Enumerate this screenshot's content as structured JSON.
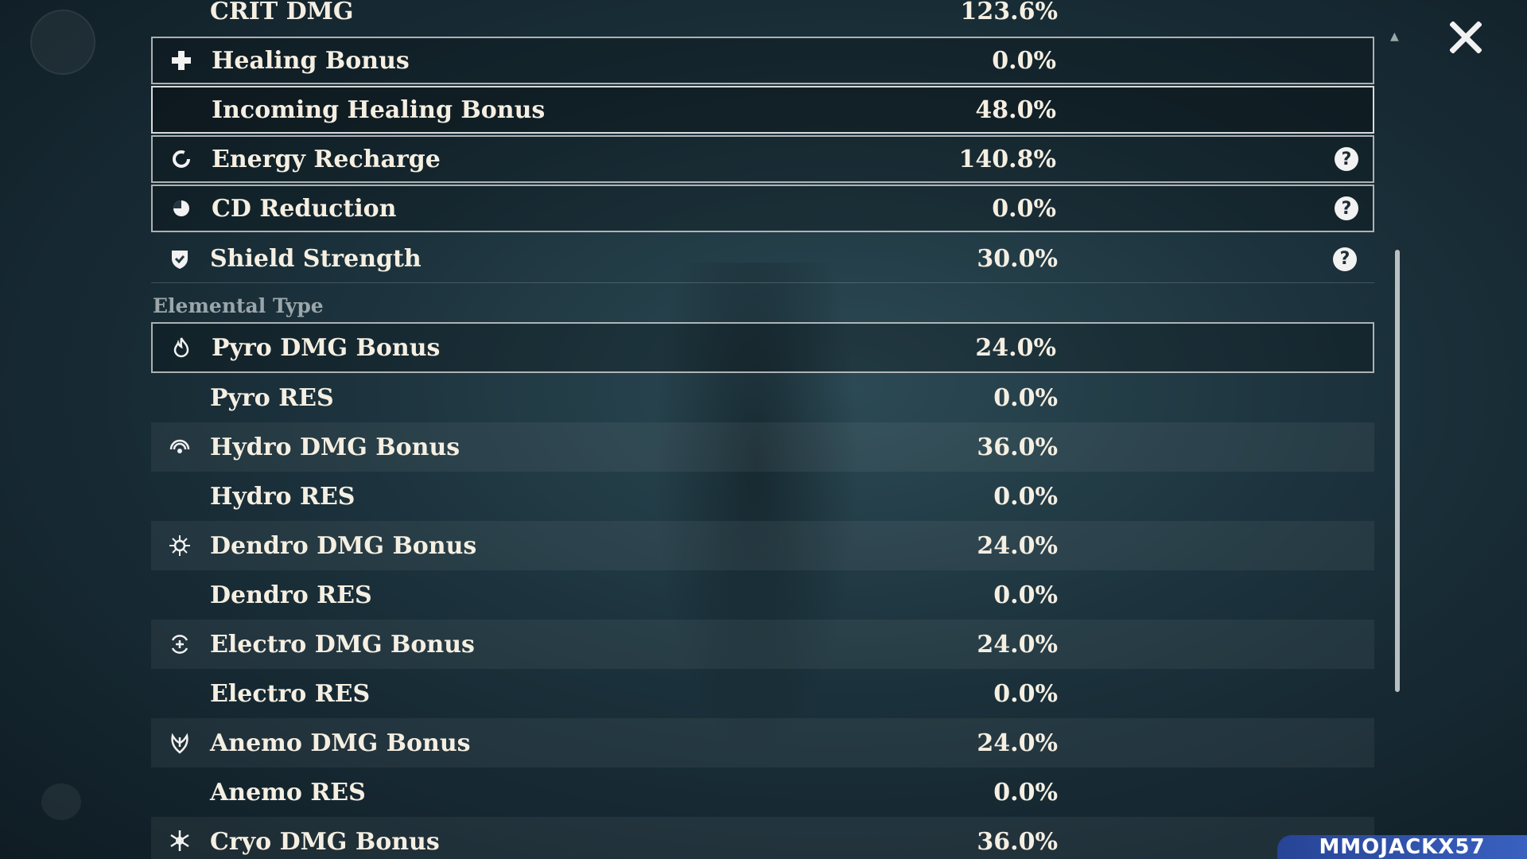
{
  "close": {
    "icon": "close-x-icon"
  },
  "stats_top": [
    {
      "label": "CRIT DMG",
      "value": "123.6%",
      "icon": null
    },
    {
      "label": "Healing Bonus",
      "value": "0.0%",
      "icon": "healing-cross-icon"
    },
    {
      "label": "Incoming Healing Bonus",
      "value": "48.0%",
      "icon": null
    },
    {
      "label": "Energy Recharge",
      "value": "140.8%",
      "icon": "energy-recharge-icon",
      "help": "?"
    },
    {
      "label": "CD Reduction",
      "value": "0.0%",
      "icon": "cd-reduction-icon",
      "help": "?"
    },
    {
      "label": "Shield Strength",
      "value": "30.0%",
      "icon": "shield-icon",
      "help": "?"
    }
  ],
  "section": {
    "title": "Elemental Type"
  },
  "elemental": [
    {
      "label": "Pyro DMG Bonus",
      "value": "24.0%",
      "icon": "pyro-icon"
    },
    {
      "label": "Pyro RES",
      "value": "0.0%",
      "icon": null
    },
    {
      "label": "Hydro DMG Bonus",
      "value": "36.0%",
      "icon": "hydro-icon"
    },
    {
      "label": "Hydro RES",
      "value": "0.0%",
      "icon": null
    },
    {
      "label": "Dendro DMG Bonus",
      "value": "24.0%",
      "icon": "dendro-icon"
    },
    {
      "label": "Dendro RES",
      "value": "0.0%",
      "icon": null
    },
    {
      "label": "Electro DMG Bonus",
      "value": "24.0%",
      "icon": "electro-icon"
    },
    {
      "label": "Electro RES",
      "value": "0.0%",
      "icon": null
    },
    {
      "label": "Anemo DMG Bonus",
      "value": "24.0%",
      "icon": "anemo-icon"
    },
    {
      "label": "Anemo RES",
      "value": "0.0%",
      "icon": null
    },
    {
      "label": "Cryo DMG Bonus",
      "value": "36.0%",
      "icon": "cryo-icon"
    }
  ],
  "watermark": {
    "text": "MMOJACKX57"
  },
  "colors": {
    "text": "#f5efe2",
    "section": "#9aa6aa",
    "border": "#e1e1e1"
  }
}
